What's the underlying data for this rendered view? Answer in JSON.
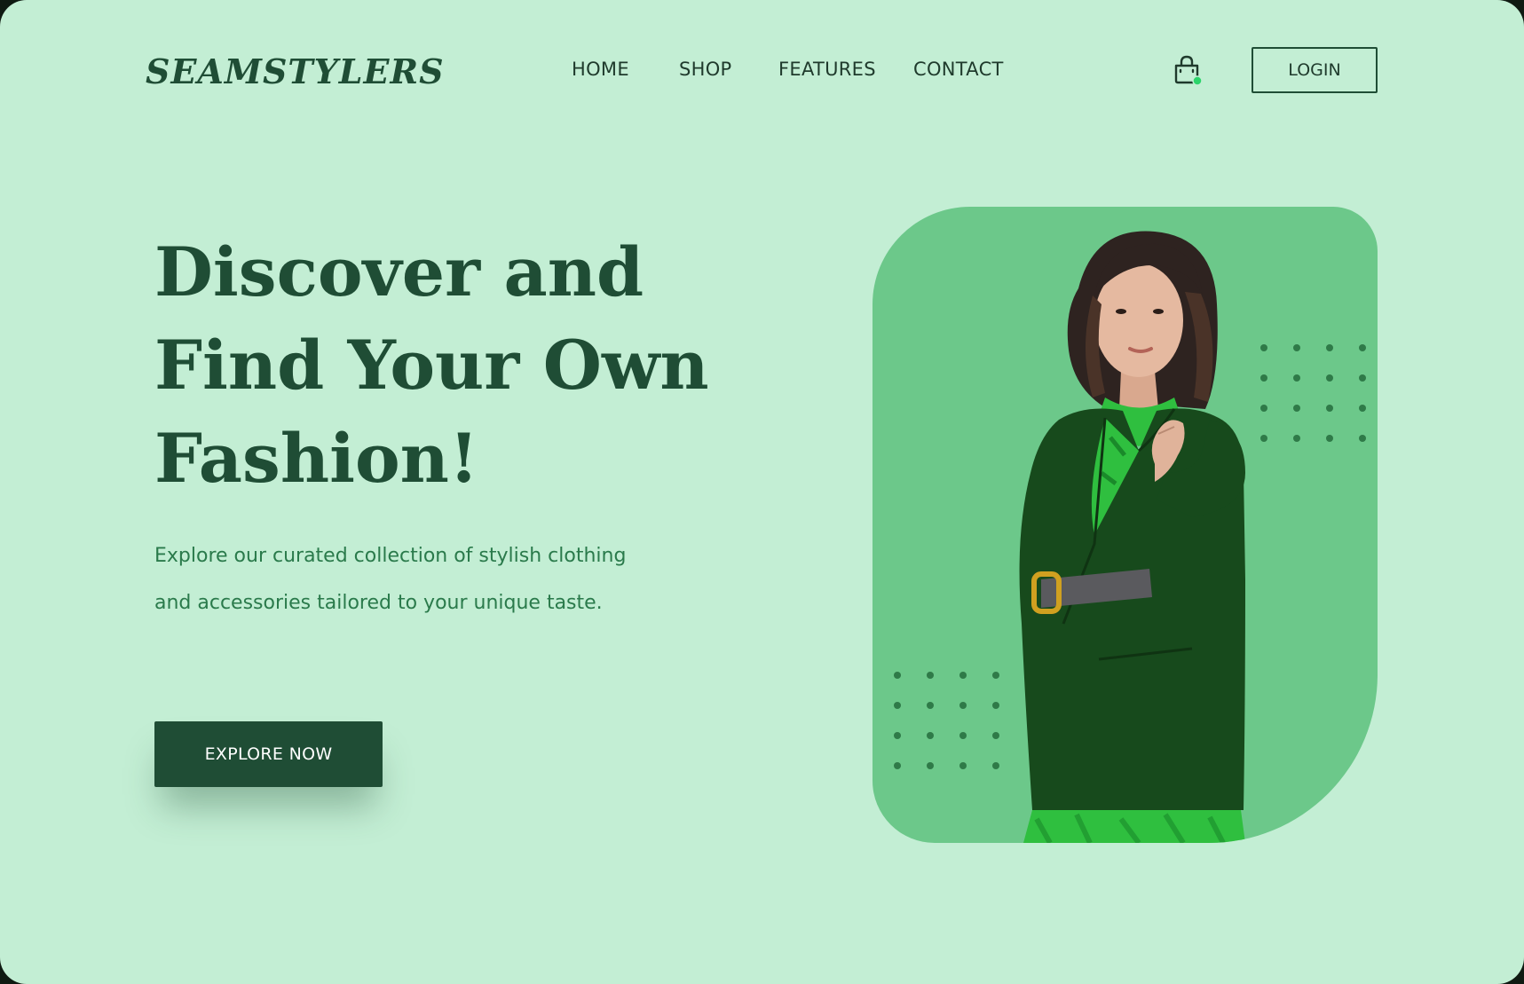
{
  "brand": {
    "logo": "SEAMSTYLERS"
  },
  "nav": {
    "items": [
      {
        "label": "HOME"
      },
      {
        "label": "SHOP"
      },
      {
        "label": "FEATURES"
      },
      {
        "label": "CONTACT"
      }
    ],
    "cart_icon": "shopping-bag-icon",
    "cart_badge_color": "#2bd46a",
    "login_label": "LOGIN"
  },
  "hero": {
    "headline_lines": [
      "Discover and",
      "Find Your Own",
      "Fashion!"
    ],
    "subtext": "Explore our curated collection of stylish clothing and accessories tailored to your unique taste.",
    "cta_label": "EXPLORE NOW",
    "image": "model-photo"
  },
  "colors": {
    "background": "#c3eed4",
    "primary": "#1f4d35",
    "card": "#6cc88a",
    "subtext": "#2a7a4b"
  }
}
